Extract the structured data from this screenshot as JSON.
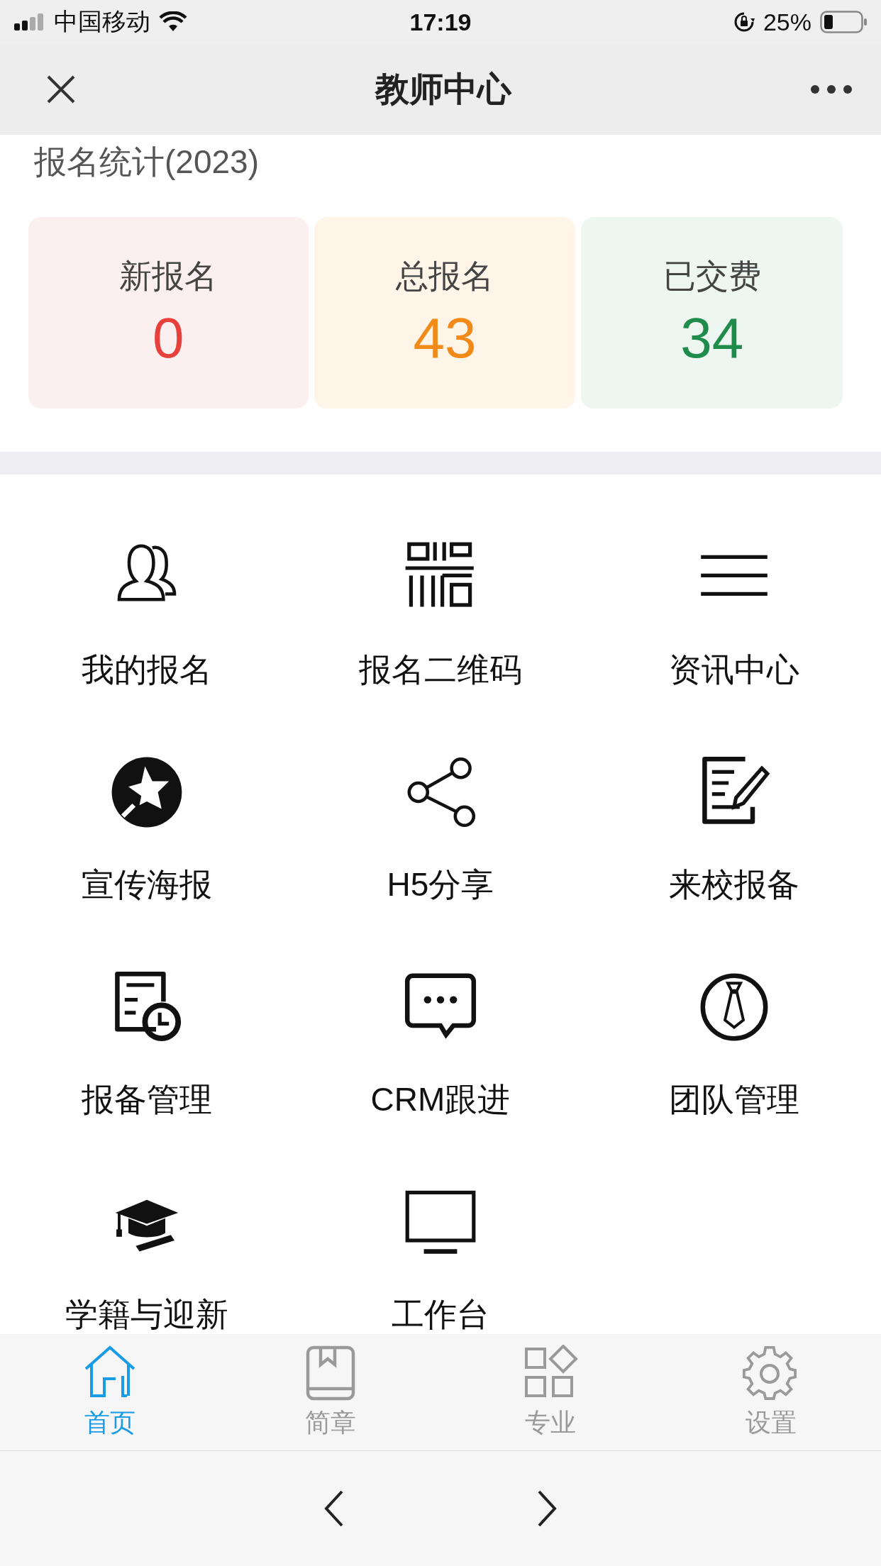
{
  "status_bar": {
    "carrier": "中国移动",
    "time": "17:19",
    "battery": "25%"
  },
  "nav_bar": {
    "title": "教师中心"
  },
  "stats": {
    "title": "报名统计(2023)",
    "cards": [
      {
        "label": "新报名",
        "value": "0",
        "color": "#e8403a"
      },
      {
        "label": "总报名",
        "value": "43",
        "color": "#f28a18"
      },
      {
        "label": "已交费",
        "value": "34",
        "color": "#1f8c4c"
      }
    ]
  },
  "menu": [
    {
      "label": "我的报名"
    },
    {
      "label": "报名二维码"
    },
    {
      "label": "资讯中心"
    },
    {
      "label": "宣传海报"
    },
    {
      "label": "H5分享"
    },
    {
      "label": "来校报备"
    },
    {
      "label": "报备管理"
    },
    {
      "label": "CRM跟进"
    },
    {
      "label": "团队管理"
    },
    {
      "label": "学籍与迎新"
    },
    {
      "label": "工作台"
    }
  ],
  "tab_bar": [
    {
      "label": "首页",
      "selected": true
    },
    {
      "label": "简章",
      "selected": false
    },
    {
      "label": "专业",
      "selected": false
    },
    {
      "label": "设置",
      "selected": false
    }
  ]
}
